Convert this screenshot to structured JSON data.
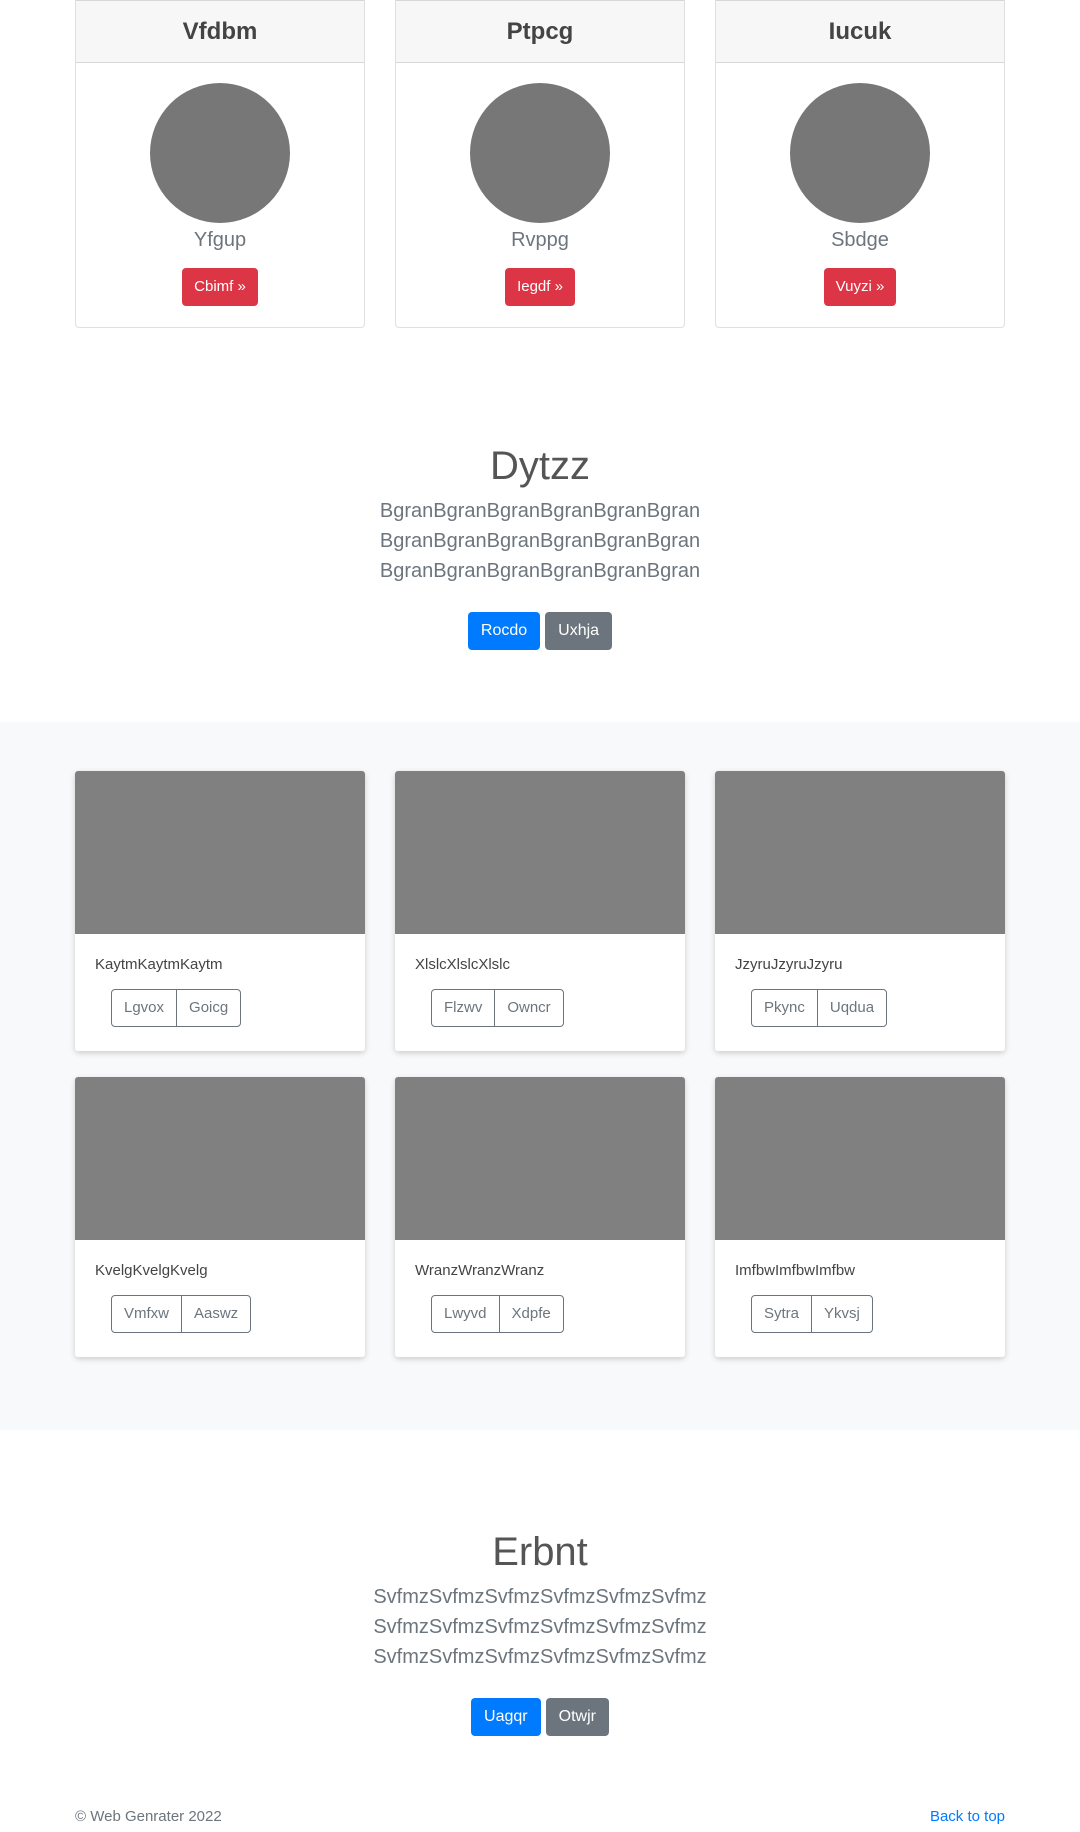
{
  "top_cards": [
    {
      "title": "Vfdbm",
      "name": "Yfgup",
      "button": "Cbimf »"
    },
    {
      "title": "Ptpcg",
      "name": "Rvppg",
      "button": "Iegdf »"
    },
    {
      "title": "Iucuk",
      "name": "Sbdge",
      "button": "Vuyzi »"
    }
  ],
  "hero1": {
    "title": "Dytzz",
    "lead": "BgranBgranBgranBgranBgranBgran BgranBgranBgranBgranBgranBgran BgranBgranBgranBgranBgranBgran",
    "primary_button": "Rocdo",
    "secondary_button": "Uxhja"
  },
  "album": {
    "cards": [
      {
        "text": "KaytmKaytmKaytm",
        "btn1": "Lgvox",
        "btn2": "Goicg"
      },
      {
        "text": "XlslcXlslcXlslc",
        "btn1": "Flzwv",
        "btn2": "Owncr"
      },
      {
        "text": "JzyruJzyruJzyru",
        "btn1": "Pkync",
        "btn2": "Uqdua"
      },
      {
        "text": "KvelgKvelgKvelg",
        "btn1": "Vmfxw",
        "btn2": "Aaswz"
      },
      {
        "text": "WranzWranzWranz",
        "btn1": "Lwyvd",
        "btn2": "Xdpfe"
      },
      {
        "text": "ImfbwImfbwImfbw",
        "btn1": "Sytra",
        "btn2": "Ykvsj"
      }
    ]
  },
  "hero2": {
    "title": "Erbnt",
    "lead": "SvfmzSvfmzSvfmzSvfmzSvfmzSvfmz SvfmzSvfmzSvfmzSvfmzSvfmzSvfmz SvfmzSvfmzSvfmzSvfmzSvfmzSvfmz",
    "primary_button": "Uagqr",
    "secondary_button": "Otwjr"
  },
  "footer": {
    "copyright": "© Web Genrater 2022",
    "back_to_top": "Back to top"
  },
  "colors": {
    "primary": "#007bff",
    "secondary": "#6c757d",
    "danger": "#dc3545",
    "placeholder": "#808080",
    "avatar": "#777777",
    "album_bg": "#f8f9fa"
  }
}
